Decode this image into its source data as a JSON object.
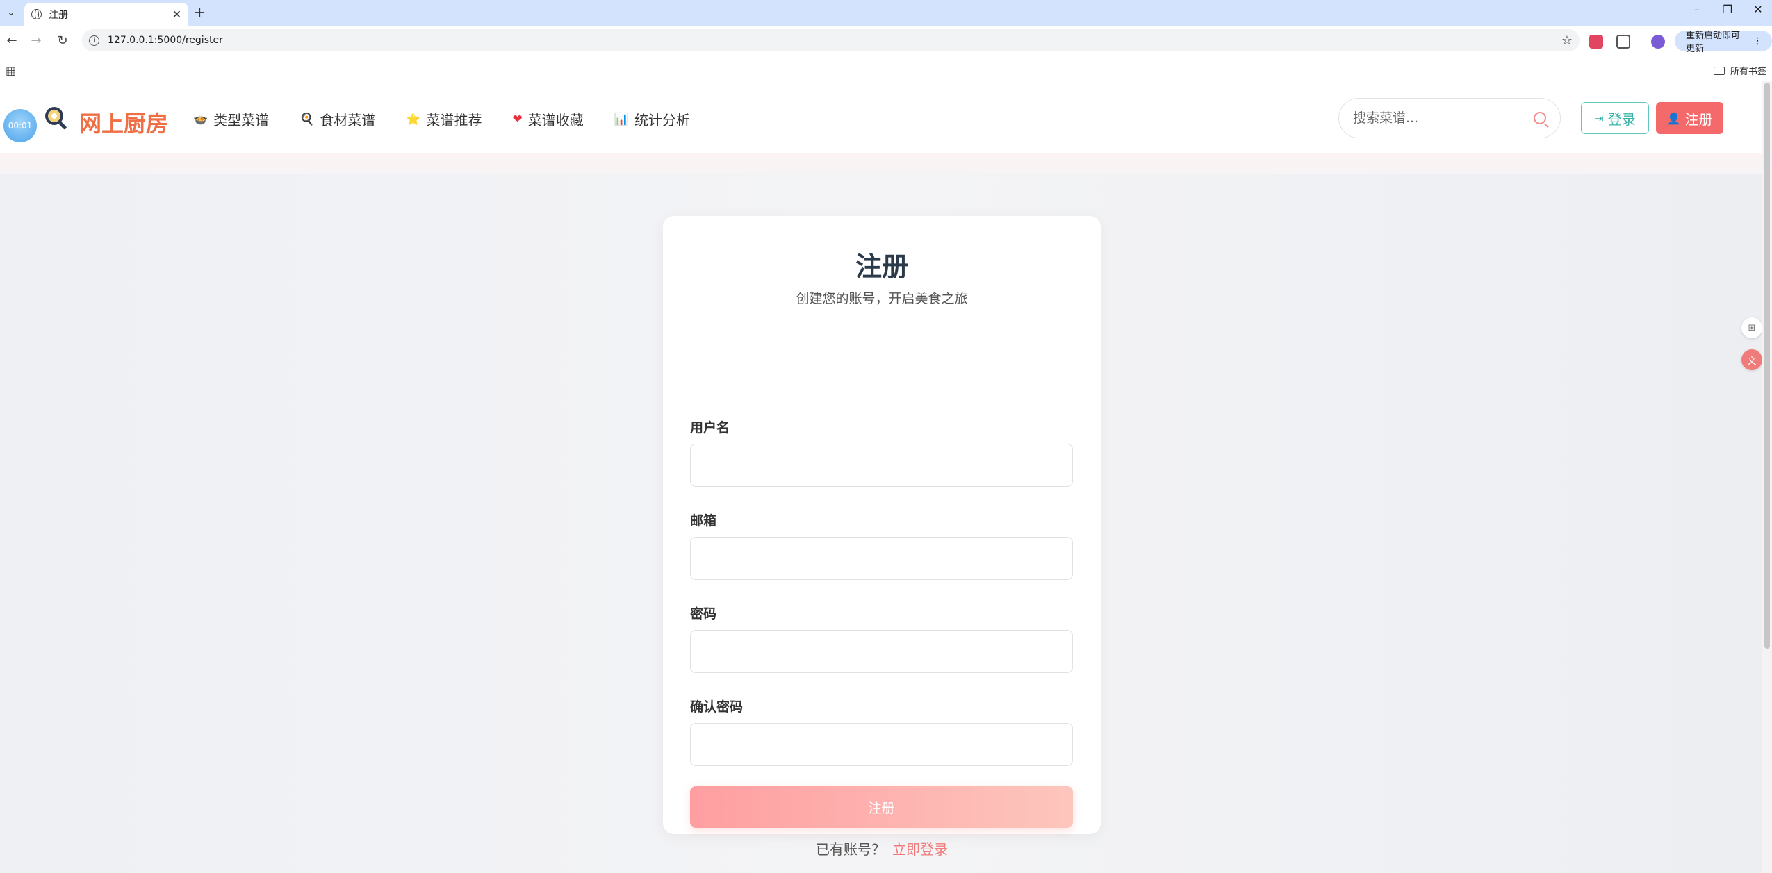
{
  "browser": {
    "tab_title": "注册",
    "url": "127.0.0.1:5000/register",
    "update_label": "重新启动即可更新",
    "all_bookmarks": "所有书签"
  },
  "header": {
    "timer": "00:01",
    "brand": "网上厨房",
    "nav": [
      {
        "icon": "🍲",
        "label": "类型菜谱"
      },
      {
        "icon": "🍳",
        "label": "食材菜谱"
      },
      {
        "icon": "⭐",
        "label": "菜谱推荐"
      },
      {
        "icon": "❤",
        "label": "菜谱收藏"
      },
      {
        "icon": "📊",
        "label": "统计分析"
      }
    ],
    "search_placeholder": "搜索菜谱...",
    "login_label": "登录",
    "register_label": "注册",
    "accent_color": "#f46a6a",
    "brand_color": "#f06e44",
    "login_color": "#39b3a9"
  },
  "form": {
    "title": "注册",
    "subtitle": "创建您的账号，开启美食之旅",
    "fields": [
      {
        "label": "用户名",
        "value": ""
      },
      {
        "label": "邮箱",
        "value": ""
      },
      {
        "label": "密码",
        "value": ""
      },
      {
        "label": "确认密码",
        "value": ""
      }
    ],
    "submit_label": "注册",
    "have_account": "已有账号？",
    "login_link": "立即登录"
  }
}
